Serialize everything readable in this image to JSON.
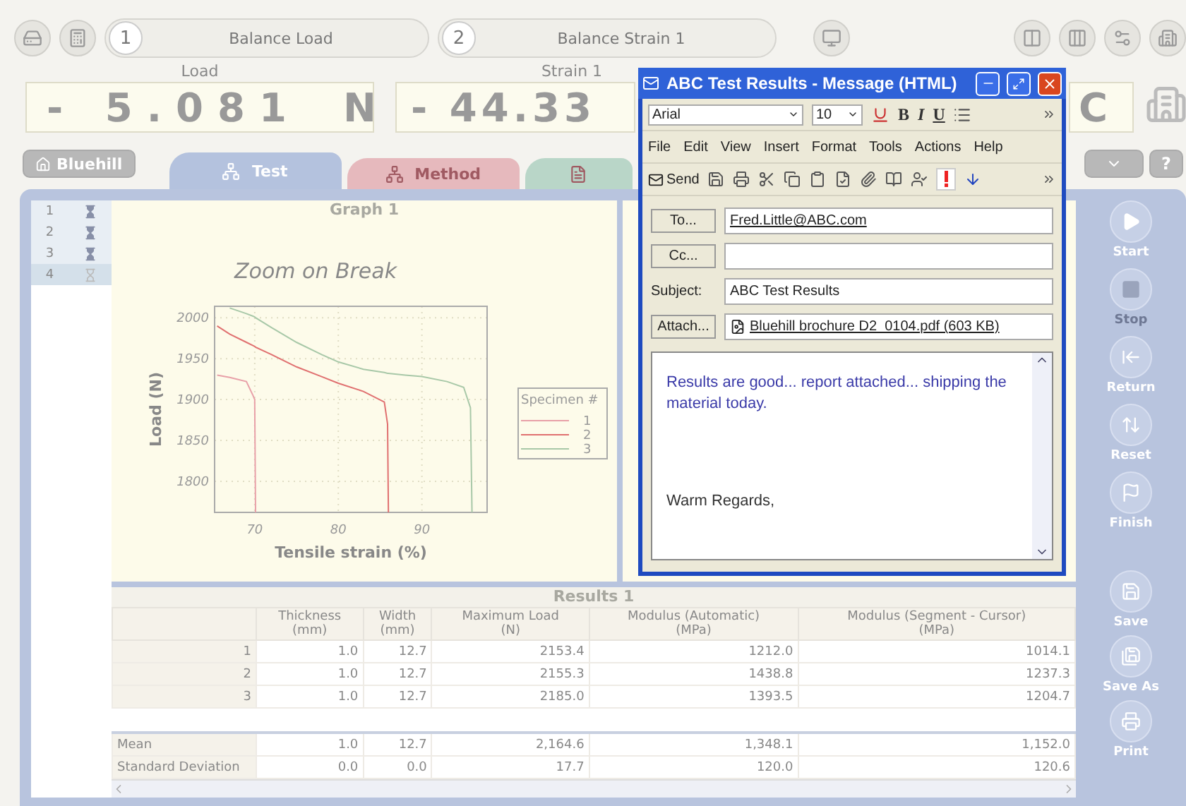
{
  "top_bar": {
    "actions": [
      {
        "number": "1",
        "label": "Balance Load"
      },
      {
        "number": "2",
        "label": "Balance Strain 1"
      }
    ]
  },
  "readouts": [
    {
      "label": "Load",
      "value": "- 5.081",
      "unit": "N"
    },
    {
      "label": "Strain 1",
      "value": "- 44.33"
    },
    {
      "value": "C"
    }
  ],
  "home_button": "Bluehill",
  "tabs": [
    {
      "label": "Test",
      "selected": true,
      "color": "#b4c2de"
    },
    {
      "label": "Method",
      "selected": false,
      "color": "#e6b9bd"
    },
    {
      "selected": false,
      "color": "#b9d6c8"
    }
  ],
  "help_button": "?",
  "specimens": [
    {
      "number": "1",
      "tested": true,
      "selected": false
    },
    {
      "number": "2",
      "tested": true,
      "selected": false
    },
    {
      "number": "3",
      "tested": true,
      "selected": false
    },
    {
      "number": "4",
      "tested": false,
      "selected": true
    }
  ],
  "graph": {
    "panel_title": "Graph 1",
    "chart_data": {
      "type": "line",
      "title": "Zoom on Break",
      "xlabel": "Tensile strain (%)",
      "ylabel": "Load (N)",
      "grid": true,
      "legend": {
        "title": "Specimen #"
      },
      "x": [
        65.5,
        67,
        69,
        69.8,
        70,
        70.1,
        72,
        75,
        78,
        80,
        83,
        85.5,
        85.9,
        86,
        88,
        90,
        93,
        95,
        95.8,
        96
      ],
      "series": [
        {
          "name": "1",
          "color": "#e8a0a8",
          "values": [
            1930,
            1927,
            1922,
            1905,
            1900,
            1762,
            null,
            null,
            null,
            null,
            null,
            null,
            null,
            null,
            null,
            null,
            null,
            null,
            null,
            null
          ]
        },
        {
          "name": "2",
          "color": "#e07070",
          "values": [
            1990,
            1980,
            1970,
            1966,
            1965,
            1964,
            1955,
            1940,
            1928,
            1920,
            1910,
            1897,
            1870,
            1762,
            null,
            null,
            null,
            null,
            null,
            null
          ]
        },
        {
          "name": "3",
          "color": "#a8c8a8",
          "values": [
            null,
            2012,
            2005,
            2002,
            2001,
            2000,
            1988,
            1970,
            1955,
            1946,
            1937,
            1933,
            1932,
            1932,
            1930,
            1928,
            1922,
            1915,
            1890,
            1762
          ]
        }
      ],
      "xlim": [
        65.2,
        97.8
      ],
      "ylim": [
        1762,
        2014
      ],
      "xticks": [
        70,
        80,
        90
      ],
      "yticks": [
        1800,
        1850,
        1900,
        1950,
        2000
      ]
    }
  },
  "results": {
    "panel_title": "Results 1",
    "columns": [
      {
        "name": "Thickness",
        "unit": "(mm)"
      },
      {
        "name": "Width",
        "unit": "(mm)"
      },
      {
        "name": "Maximum Load",
        "unit": "(N)"
      },
      {
        "name": "Modulus (Automatic)",
        "unit": "(MPa)"
      },
      {
        "name": "Modulus (Segment - Cursor)",
        "unit": "(MPa)"
      }
    ],
    "rows": [
      {
        "label": "1",
        "cells": [
          "1.0",
          "12.7",
          "2153.4",
          "1212.0",
          "1014.1"
        ]
      },
      {
        "label": "2",
        "cells": [
          "1.0",
          "12.7",
          "2155.3",
          "1438.8",
          "1237.3"
        ]
      },
      {
        "label": "3",
        "cells": [
          "1.0",
          "12.7",
          "2185.0",
          "1393.5",
          "1204.7"
        ]
      }
    ],
    "statistics": [
      {
        "label": "Mean",
        "cells": [
          "1.0",
          "12.7",
          "2,164.6",
          "1,348.1",
          "1,152.0"
        ]
      },
      {
        "label": "Standard Deviation",
        "cells": [
          "0.0",
          "0.0",
          "17.7",
          "120.0",
          "120.6"
        ]
      }
    ]
  },
  "sidebar": [
    {
      "label": "Start",
      "disabled": false
    },
    {
      "label": "Stop",
      "disabled": true
    },
    {
      "label": "Return",
      "disabled": false
    },
    {
      "label": "Reset",
      "disabled": false
    },
    {
      "label": "Finish",
      "disabled": false
    },
    {
      "label": "Save",
      "disabled": false
    },
    {
      "label": "Save As",
      "disabled": false
    },
    {
      "label": "Print",
      "disabled": false
    }
  ],
  "email": {
    "title": "ABC Test Results - Message (HTML)",
    "font": "Arial",
    "size": "10",
    "format_buttons": [
      "B",
      "I",
      "U"
    ],
    "menu": [
      "File",
      "Edit",
      "View",
      "Insert",
      "Format",
      "Tools",
      "Actions",
      "Help"
    ],
    "send": "Send",
    "fields": [
      {
        "kind": "button",
        "label": "To...",
        "value": "Fred.Little@ABC.com"
      },
      {
        "kind": "button",
        "label": "Cc..."
      },
      {
        "kind": "text",
        "label": "Subject:",
        "value": "ABC Test Results"
      },
      {
        "kind": "attach",
        "label": "Attach...",
        "value": "Bluehill brochure D2_0104.pdf (603 KB)"
      }
    ],
    "body": [
      "Results are good... report attached... shipping the material today.",
      "Warm Regards,"
    ]
  }
}
